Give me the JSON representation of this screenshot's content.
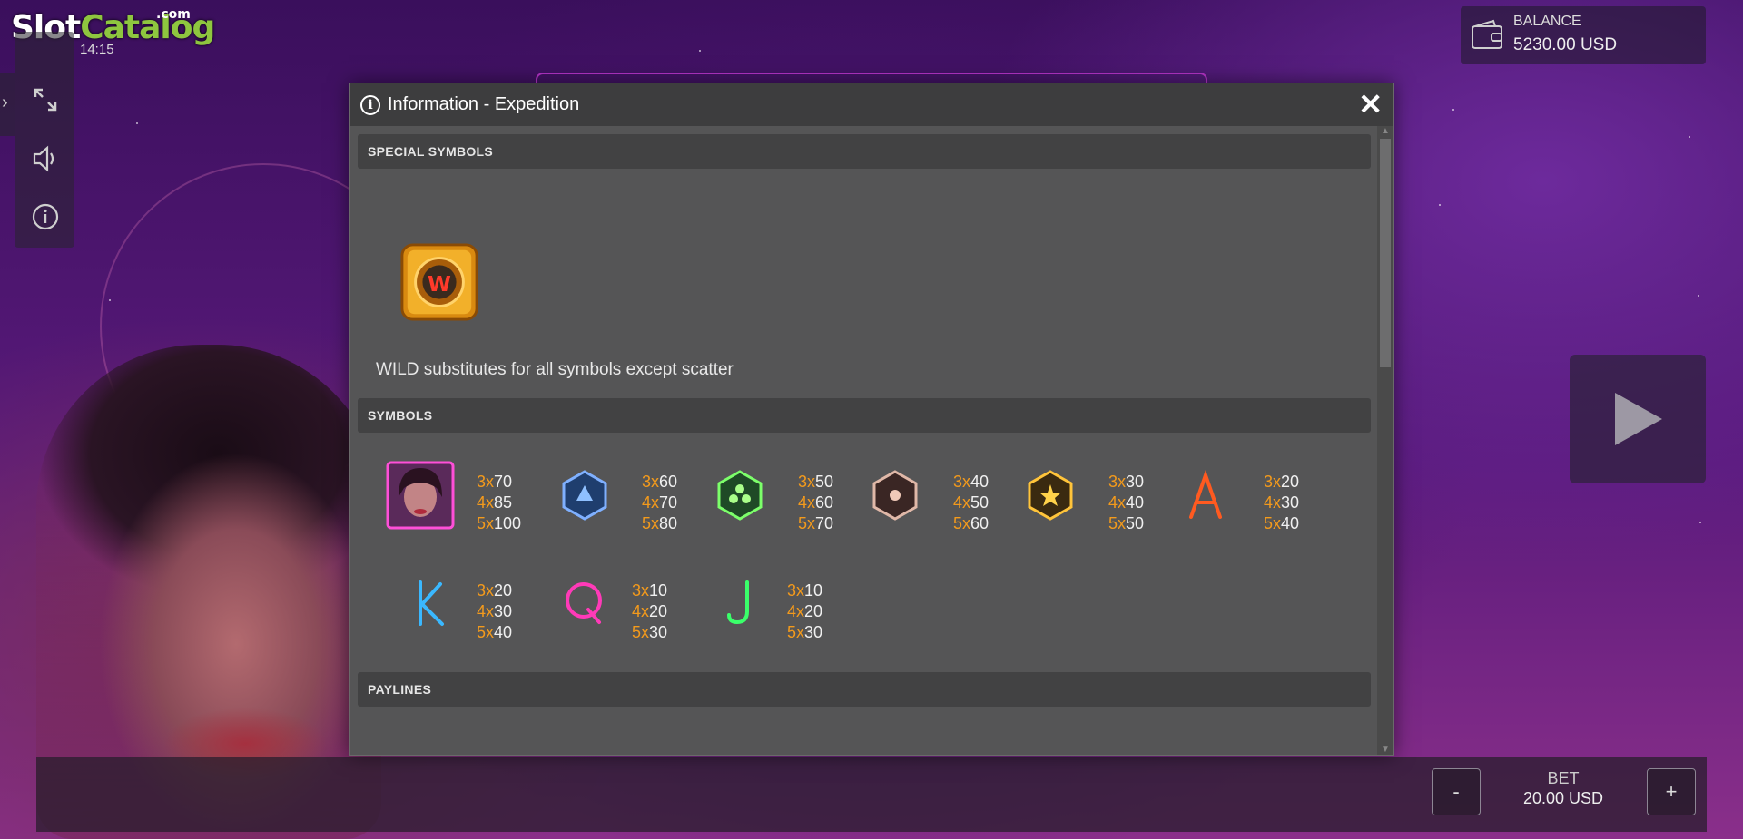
{
  "logo": {
    "word1": "Slot",
    "word2": "Catalog",
    "suffix": ".com"
  },
  "clock": "14:15",
  "balance": {
    "label": "BALANCE",
    "value": "5230.00 USD"
  },
  "bet": {
    "label": "BET",
    "value": "20.00 USD",
    "minus": "-",
    "plus": "+"
  },
  "modal": {
    "title": "Information - Expedition",
    "close": "✕",
    "sections": {
      "special": "SPECIAL SYMBOLS",
      "symbols": "SYMBOLS",
      "paylines": "PAYLINES"
    },
    "wild_text": "WILD substitutes for all symbols except scatter",
    "symbols": [
      {
        "icon": "girl-symbol-icon",
        "pays": [
          [
            "3x",
            "70"
          ],
          [
            "4x",
            "85"
          ],
          [
            "5x",
            "100"
          ]
        ]
      },
      {
        "icon": "blue-hex-symbol-icon",
        "pays": [
          [
            "3x",
            "60"
          ],
          [
            "4x",
            "70"
          ],
          [
            "5x",
            "80"
          ]
        ]
      },
      {
        "icon": "green-hex-symbol-icon",
        "pays": [
          [
            "3x",
            "50"
          ],
          [
            "4x",
            "60"
          ],
          [
            "5x",
            "70"
          ]
        ]
      },
      {
        "icon": "bronze-hex-symbol-icon",
        "pays": [
          [
            "3x",
            "40"
          ],
          [
            "4x",
            "50"
          ],
          [
            "5x",
            "60"
          ]
        ]
      },
      {
        "icon": "gold-hex-symbol-icon",
        "pays": [
          [
            "3x",
            "30"
          ],
          [
            "4x",
            "40"
          ],
          [
            "5x",
            "50"
          ]
        ]
      },
      {
        "icon": "letter-a-symbol-icon",
        "pays": [
          [
            "3x",
            "20"
          ],
          [
            "4x",
            "30"
          ],
          [
            "5x",
            "40"
          ]
        ]
      },
      {
        "icon": "letter-k-symbol-icon",
        "pays": [
          [
            "3x",
            "20"
          ],
          [
            "4x",
            "30"
          ],
          [
            "5x",
            "40"
          ]
        ]
      },
      {
        "icon": "letter-q-symbol-icon",
        "pays": [
          [
            "3x",
            "10"
          ],
          [
            "4x",
            "20"
          ],
          [
            "5x",
            "30"
          ]
        ]
      },
      {
        "icon": "letter-j-symbol-icon",
        "pays": [
          [
            "3x",
            "10"
          ],
          [
            "4x",
            "20"
          ],
          [
            "5x",
            "30"
          ]
        ]
      }
    ],
    "paylines": [
      [
        [
          1,
          1,
          1,
          1,
          1
        ],
        [
          0,
          0,
          0,
          0,
          0
        ]
      ],
      [
        [
          0,
          0,
          0,
          0,
          0
        ],
        [
          1,
          1,
          1,
          1,
          1
        ]
      ],
      [
        [
          0,
          0,
          0,
          0,
          0
        ],
        [
          0,
          0,
          0,
          0,
          0
        ]
      ],
      [
        [
          1,
          0,
          0,
          0,
          1
        ],
        [
          0,
          1,
          0,
          1,
          0
        ]
      ],
      [
        [
          0,
          0,
          1,
          0,
          0
        ],
        [
          0,
          1,
          0,
          1,
          0
        ]
      ],
      [
        [
          1,
          0,
          0,
          0,
          1
        ],
        [
          0,
          1,
          1,
          1,
          0
        ]
      ],
      [
        [
          0,
          0,
          0,
          0,
          0
        ],
        [
          1,
          0,
          1,
          0,
          1
        ]
      ],
      [
        [
          0,
          0,
          0,
          0,
          0
        ],
        [
          0,
          1,
          0,
          1,
          0
        ]
      ]
    ]
  },
  "colors": {
    "accent": "#f39a1c",
    "payline_on": "#ff7a00",
    "modal_bg": "#555556"
  }
}
